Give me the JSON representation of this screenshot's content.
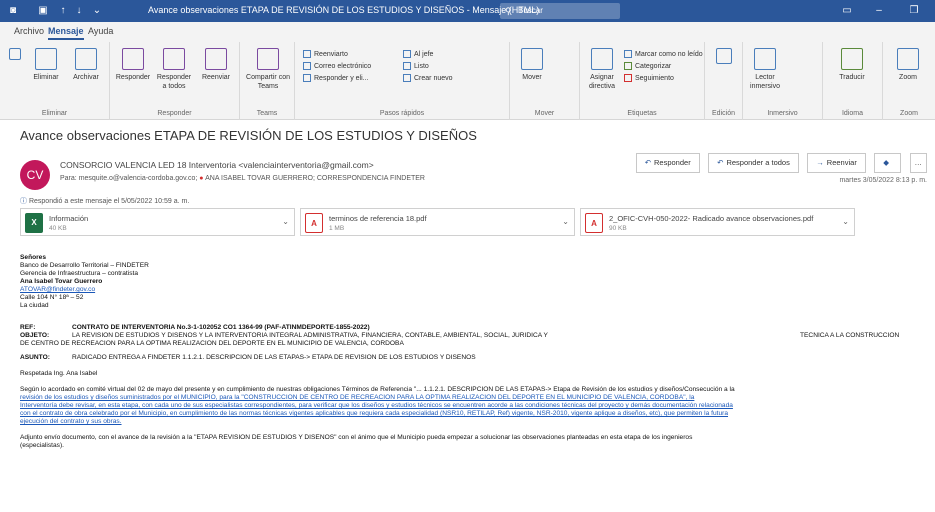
{
  "window": {
    "title": "Avance observaciones ETAPA DE REVISIÓN DE LOS ESTUDIOS Y DISEÑOS  -  Mensaje (HTML)",
    "search_placeholder": "Buscar",
    "search_icon": "search-icon"
  },
  "tabs": [
    "Archivo",
    "Mensaje",
    "Ayuda"
  ],
  "ribbon": {
    "groups": {
      "eliminar": "Eliminar",
      "responder": "Responder",
      "teams": "Teams",
      "pasos_rapidos": "Pasos rápidos",
      "mover": "Mover",
      "etiquetas": "Etiquetas",
      "edicion": "Edición",
      "inmersivo": "Inmersivo",
      "idioma": "Idioma",
      "zoom": "Zoom"
    },
    "buttons": {
      "eliminar": "Eliminar",
      "archivar": "Archivar",
      "responder": "Responder",
      "responder_todos": "Responder a todos",
      "reenviar": "Reenviar",
      "compartir_teams": "Compartir con Teams",
      "mover": "Mover",
      "asignar_directiva": "Asignar directiva",
      "marcar_no_leido": "Marcar como no leído",
      "categorizar": "Categorizar",
      "seguimiento": "Seguimiento",
      "lector_inmersivo": "Lector inmersivo",
      "traducir": "Traducir",
      "zoom": "Zoom"
    },
    "quick_steps": [
      "Reenviarto",
      "Correo electrónico",
      "Responder y eli...",
      "Al jefe",
      "Listo",
      "Crear nuevo"
    ]
  },
  "message": {
    "subject": "Avance observaciones ETAPA DE REVISIÓN DE LOS ESTUDIOS Y DISEÑOS",
    "avatar_initials": "CV",
    "sender": "CONSORCIO VALENCIA LED 18 Interventoria <valenciainterventoria@gmail.com>",
    "recipients_prefix": "Para:",
    "recipients": "mesquite.o@valencia-cordoba.gov.co;",
    "recipients_more": "ANA ISABEL TOVAR GUERRERO;  CORRESPONDENCIA FINDETER",
    "date": "martes 3/05/2022 8:13 p. m.",
    "reply_notice": "Respondió a este mensaje el 5/05/2022 10:59 a. m.",
    "actions": [
      "Responder",
      "Responder a todos",
      "Reenviar"
    ]
  },
  "attachments": [
    {
      "name": "Información",
      "size": "40 KB",
      "type": "xl"
    },
    {
      "name": "terminos de referencia 18.pdf",
      "size": "1 MB",
      "type": "pdf"
    },
    {
      "name": "2_OFIC-CVH-050-2022- Radicado avance observaciones.pdf",
      "size": "90 KB",
      "type": "pdf"
    }
  ],
  "body": {
    "greeting": "Señores",
    "addr1": "Banco de Desarrollo Territorial – FINDETER",
    "addr2": "Gerencia de Infraestructura – contratista",
    "addr3": "Ana Isabel Tovar Guerrero",
    "email": "ATOVAR@findeter.gov.co",
    "addr4": "Calle 104 N° 18ª – 52",
    "addr5": "La ciudad",
    "ref_label": "REF:",
    "ref_text": "CONTRATO DE INTERVENTORIA No.3-1-102052 CO1 1364-99 (PAF-ATINMDEPORTE-1855-2022)",
    "obj_label": "OBJETO:",
    "obj_text": "LA REVISIÓN DE ESTUDIOS Y DISEÑOS Y LA INTERVENTORIA INTEGRAL ADMINISTRATIVA, FINANCIERA, CONTABLE, AMBIENTAL, SOCIAL, JURIDICA Y",
    "obj_right": "TECNICA A LA CONSTRUCCIÓN",
    "obj_text2": "DE CENTRO DE RECREACIÓN PARA LA ÓPTIMA REALIZACIÓN DEL DEPORTE EN EL MUNICIPIO DE VALENCIA, CÓRDOBA",
    "asunto_label": "ASUNTO:",
    "asunto_text": "RADICADO ENTREGA A FINDETER 1.1.2.1. DESCRIPCIÓN DE LAS ETAPAS-> ETAPA DE REVISIÓN DE LOS ESTUDIOS Y DISEÑOS",
    "salutation": "Respetada Ing. Ana Isabel",
    "p1_l1": "Según lo acordado en comité virtual del 02 de mayo del presente y en cumplimiento de nuestras obligaciones Términos de Referencia \"... 1.1.2.1. DESCRIPCIÓN DE LAS ETAPAS-> Etapa de Revisión de los estudios y diseños/Consecución a la",
    "p1_l2": "revisión de los estudios y diseños suministrados por el MUNICIPIO, para la \"CONSTRUCCIÓN DE CENTRO DE RECREACIÓN PARA LA ÓPTIMA REALIZACIÓN DEL DEPORTE EN EL MUNICIPIO DE VALENCIA, CÓRDOBA\", la",
    "p1_l3": "Interventoría debe revisar, en esta etapa, con cada uno de sus especialistas correspondientes, para verificar que los diseños y estudios técnicos se encuentren acorde a las condiciones técnicas del proyecto y demás documentación relacionada",
    "p1_l4": "con el contrato de obra celebrado por el Municipio, en cumplimiento de las normas técnicas vigentes aplicables que requiera cada especialidad (NSR10, RETILAP, Ref) vigente, NSR-2010, vigente aplique a diseños, etc), que permiten la futura",
    "p1_l5": "ejecución del contrato y sus obras.",
    "p2_l1": "Adjunto envío documento, con el avance de la revisión a la \"ETAPA REVISIÓN DE ESTUDIOS Y DISEÑOS\" con el ánimo que el Municipio pueda empezar a solucionar las observaciones planteadas en esta etapa de los ingenieros",
    "p2_l2": "(especialistas)."
  }
}
